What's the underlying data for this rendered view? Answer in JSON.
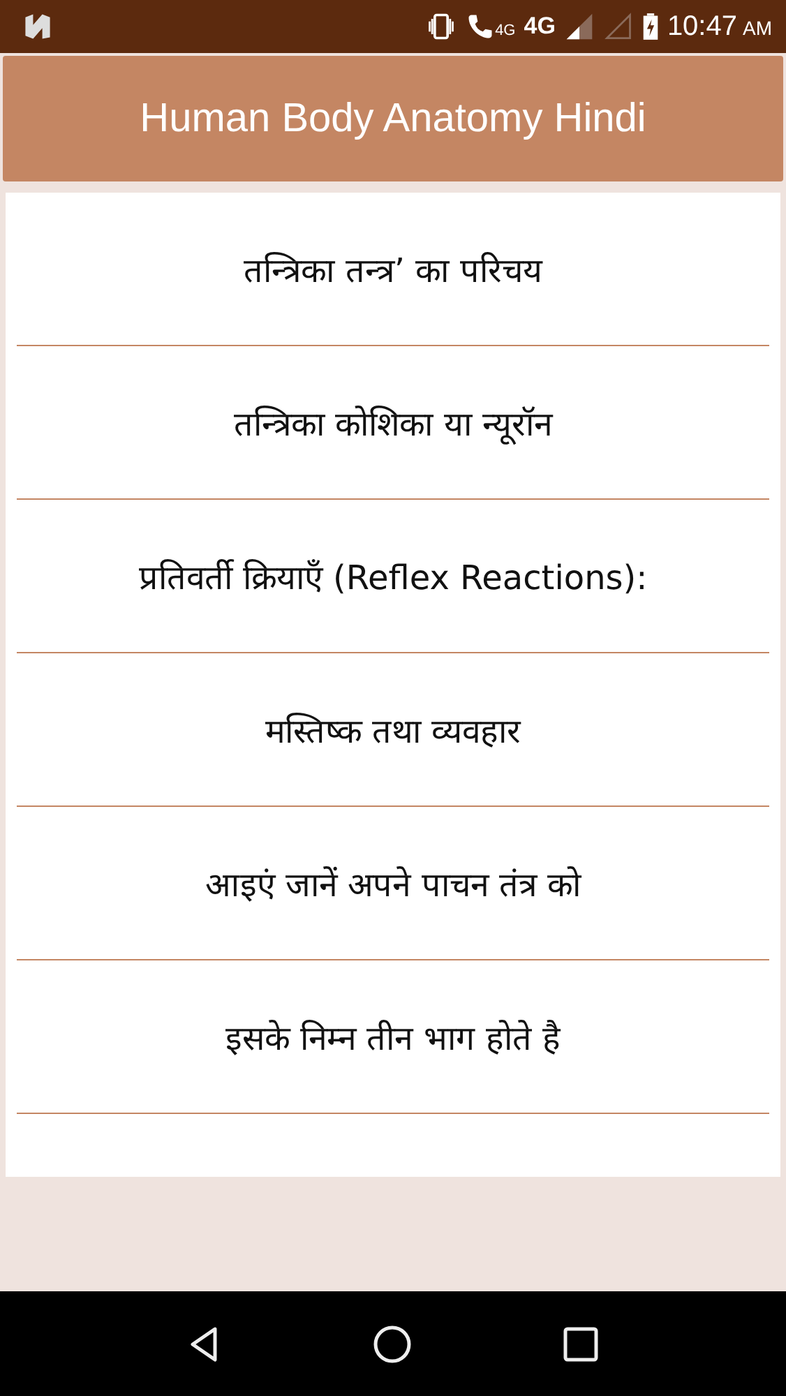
{
  "status_bar": {
    "call_network": "4G",
    "network": "4G",
    "time": "10:47",
    "meridiem": "AM"
  },
  "app_bar": {
    "title": "Human Body Anatomy Hindi"
  },
  "topics": [
    {
      "title": "तन्त्रिका तन्त्र’  का परिचय"
    },
    {
      "title": "तन्त्रिका कोशिका या न्यूरॉन"
    },
    {
      "title": "प्रतिवर्ती क्रियाएँ (Reflex Reactions):"
    },
    {
      "title": "मस्तिष्क तथा व्यवहार"
    },
    {
      "title": "आइएं जानें अपने पाचन तंत्र को"
    },
    {
      "title": "इसके निम्न तीन भाग होते है"
    }
  ]
}
